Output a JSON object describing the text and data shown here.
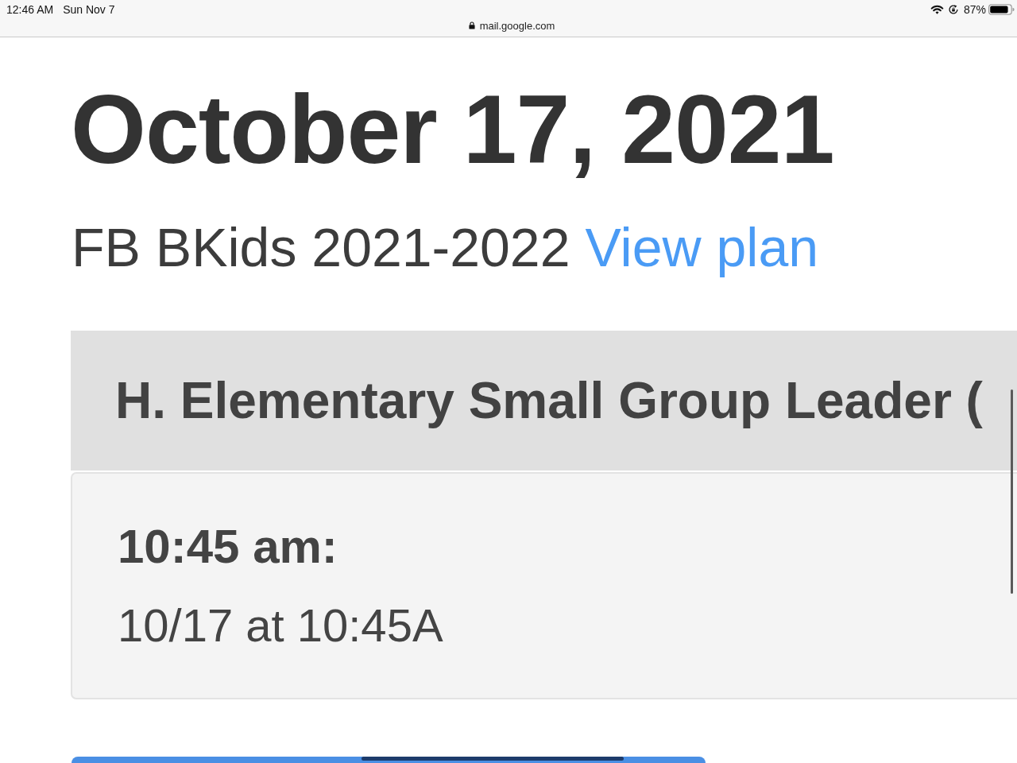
{
  "status_bar": {
    "time": "12:46 AM",
    "date": "Sun Nov 7",
    "battery": "87%"
  },
  "address_bar": {
    "url": "mail.google.com"
  },
  "page": {
    "title": "October 17, 2021",
    "subtitle": "FB BKids 2021-2022",
    "link": "View plan"
  },
  "schedule": [
    {
      "heading": "H. Elementary Small Group Leader (",
      "times": [
        {
          "label": "10:45 am:",
          "detail": "10/17 at 10:45A"
        }
      ]
    }
  ]
}
